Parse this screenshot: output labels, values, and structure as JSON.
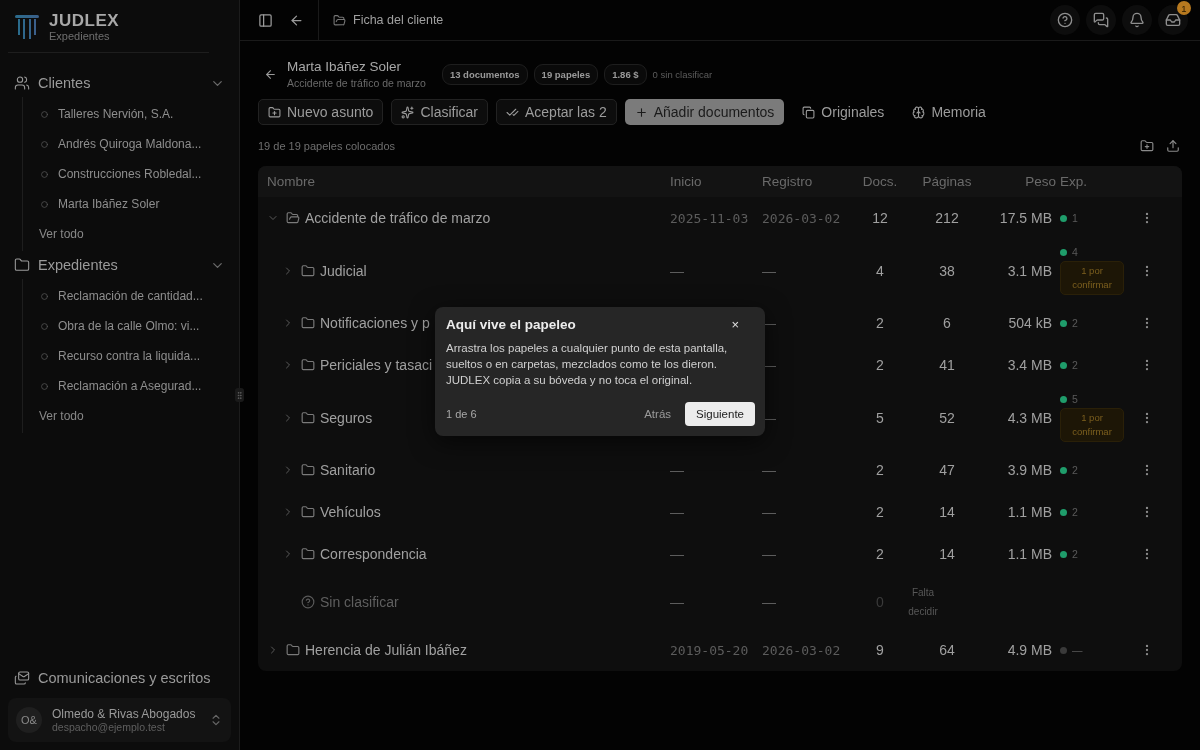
{
  "sidebar": {
    "brand": {
      "name": "JUDLEX",
      "subtitle": "Expedientes"
    },
    "sections": [
      {
        "label": "Clientes",
        "expanded": true,
        "items": [
          "Talleres Nervión, S.A.",
          "Andrés Quiroga Maldona...",
          "Construcciones Robledal...",
          "Marta Ibáñez Soler"
        ],
        "more": "Ver todo"
      },
      {
        "label": "Expedientes",
        "expanded": true,
        "items": [
          "Reclamación de cantidad...",
          "Obra de la calle Olmo: vi...",
          "Recurso contra la liquida...",
          "Reclamación a Asegurad..."
        ],
        "more": "Ver todo"
      }
    ],
    "footer_link": "Comunicaciones y escritos",
    "account": {
      "initials": "O&",
      "name": "Olmedo & Rivas Abogados",
      "email": "despacho@ejemplo.test"
    }
  },
  "topbar": {
    "breadcrumb": "Ficha del cliente",
    "notification_count": "1"
  },
  "header": {
    "title": "Marta Ibáñez Soler",
    "subtitle": "Accidente de tráfico de marzo",
    "chips": [
      "13 documentos",
      "19 papeles",
      "1.86 $"
    ],
    "note": "0 sin clasificar"
  },
  "toolbar": [
    {
      "label": "Nuevo asunto",
      "kind": "outline"
    },
    {
      "label": "Clasificar",
      "kind": "outline"
    },
    {
      "label": "Aceptar las 2",
      "kind": "outline"
    },
    {
      "label": "Añadir documentos",
      "kind": "primary"
    },
    {
      "label": "Originales",
      "kind": "ghost"
    },
    {
      "label": "Memoria",
      "kind": "ghost"
    }
  ],
  "placed_summary": "19 de 19 papeles colocados",
  "table": {
    "columns": [
      "Nombre",
      "Inicio",
      "Registro",
      "Docs.",
      "Páginas",
      "Peso",
      "Exp."
    ],
    "rows": [
      {
        "name": "Accidente de tráfico de marzo",
        "kind": "case",
        "expanded": true,
        "start": "2025-11-03",
        "registered": "2026-03-02",
        "docs": "12",
        "pages": "212",
        "size": "17.5 MB",
        "exp": {
          "count": "1",
          "color": "#1f9d6b"
        },
        "children": [
          {
            "name": "Judicial",
            "kind": "folder",
            "expanded": false,
            "start": "—",
            "registered": "—",
            "docs": "4",
            "pages": "38",
            "size": "3.1 MB",
            "exp": {
              "count": "4",
              "color": "#1f9d6b"
            },
            "pending": "1 por confirmar"
          },
          {
            "name": "Notificaciones y p",
            "kind": "folder",
            "expanded": false,
            "registered": "—",
            "docs": "2",
            "pages": "6",
            "size": "504 kB",
            "exp": {
              "count": "2",
              "color": "#1f9d6b"
            }
          },
          {
            "name": "Periciales y tasaci",
            "kind": "folder",
            "expanded": false,
            "registered": "—",
            "docs": "2",
            "pages": "41",
            "size": "3.4 MB",
            "exp": {
              "count": "2",
              "color": "#1f9d6b"
            }
          },
          {
            "name": "Seguros",
            "kind": "folder",
            "expanded": false,
            "registered": "—",
            "docs": "5",
            "pages": "52",
            "size": "4.3 MB",
            "exp": {
              "count": "5",
              "color": "#1f9d6b"
            },
            "pending": "1 por confirmar"
          },
          {
            "name": "Sanitario",
            "kind": "folder",
            "expanded": false,
            "start": "—",
            "registered": "—",
            "docs": "2",
            "pages": "47",
            "size": "3.9 MB",
            "exp": {
              "count": "2",
              "color": "#1f9d6b"
            }
          },
          {
            "name": "Vehículos",
            "kind": "folder",
            "expanded": false,
            "start": "—",
            "registered": "—",
            "docs": "2",
            "pages": "14",
            "size": "1.1 MB",
            "exp": {
              "count": "2",
              "color": "#1f9d6b"
            }
          },
          {
            "name": "Correspondencia",
            "kind": "folder",
            "expanded": false,
            "start": "—",
            "registered": "—",
            "docs": "2",
            "pages": "14",
            "size": "1.1 MB",
            "exp": {
              "count": "2",
              "color": "#1f9d6b"
            }
          },
          {
            "name": "Sin clasificar",
            "kind": "unclassified",
            "start": "—",
            "registered": "—",
            "docs": "0",
            "status": "Falta decidir"
          }
        ]
      },
      {
        "name": "Herencia de Julián Ibáñez",
        "kind": "case",
        "expanded": false,
        "start": "2019-05-20",
        "registered": "2026-03-02",
        "docs": "9",
        "pages": "64",
        "size": "4.9 MB",
        "exp": {
          "count": "—",
          "color": "#3a3a3a"
        }
      }
    ]
  },
  "tour": {
    "title": "Aquí vive el papeleo",
    "close": "×",
    "body": "Arrastra los papeles a cualquier punto de esta pantalla, sueltos o en carpetas, mezclados como te los dieron. JUDLEX copia a su bóveda y no toca el original.",
    "step": "1 de 6",
    "back": "Atrás",
    "next": "Siguiente"
  }
}
